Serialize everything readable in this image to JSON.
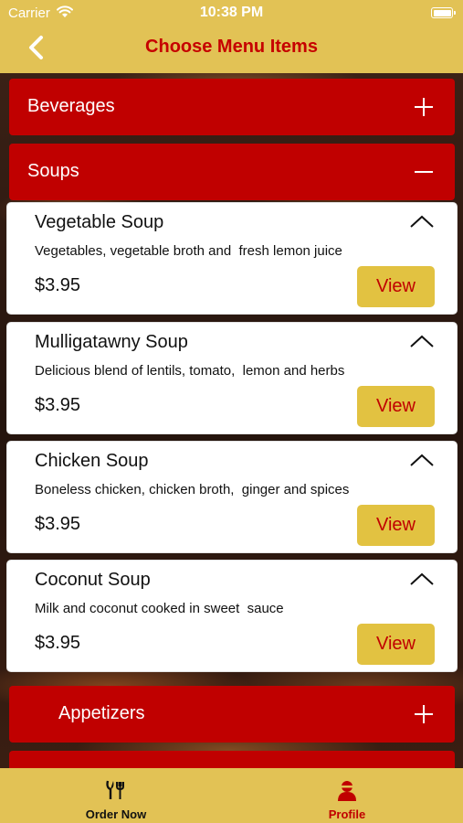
{
  "status_bar": {
    "carrier": "Carrier",
    "time": "10:38 PM"
  },
  "header": {
    "title": "Choose Menu Items",
    "back_icon": "chevron-left-icon"
  },
  "categories": [
    {
      "label": "Beverages",
      "state_icon": "plus-icon"
    },
    {
      "label": "Soups",
      "state_icon": "minus-icon"
    },
    {
      "label": "Appetizers",
      "state_icon": "plus-icon"
    }
  ],
  "soups": [
    {
      "name": "Vegetable Soup",
      "description": "Vegetables, vegetable broth and  fresh lemon juice",
      "price": "$3.95",
      "button": "View"
    },
    {
      "name": "Mulligatawny Soup",
      "description": "Delicious blend of lentils, tomato,  lemon and herbs",
      "price": "$3.95",
      "button": "View"
    },
    {
      "name": "Chicken Soup",
      "description": "Boneless chicken, chicken broth,  ginger and spices",
      "price": "$3.95",
      "button": "View"
    },
    {
      "name": "Coconut Soup",
      "description": "Milk and coconut cooked in sweet  sauce",
      "price": "$3.95",
      "button": "View"
    }
  ],
  "tabs": [
    {
      "label": "Order Now",
      "icon": "dining-icon",
      "active": false
    },
    {
      "label": "Profile",
      "icon": "user-icon",
      "active": true
    }
  ],
  "colors": {
    "header_bg": "#e2c255",
    "accent_red": "#c00000",
    "title_red": "#c60000",
    "button_gold": "#e2c241",
    "tab_inactive": "#111111",
    "tab_active": "#c00000"
  }
}
